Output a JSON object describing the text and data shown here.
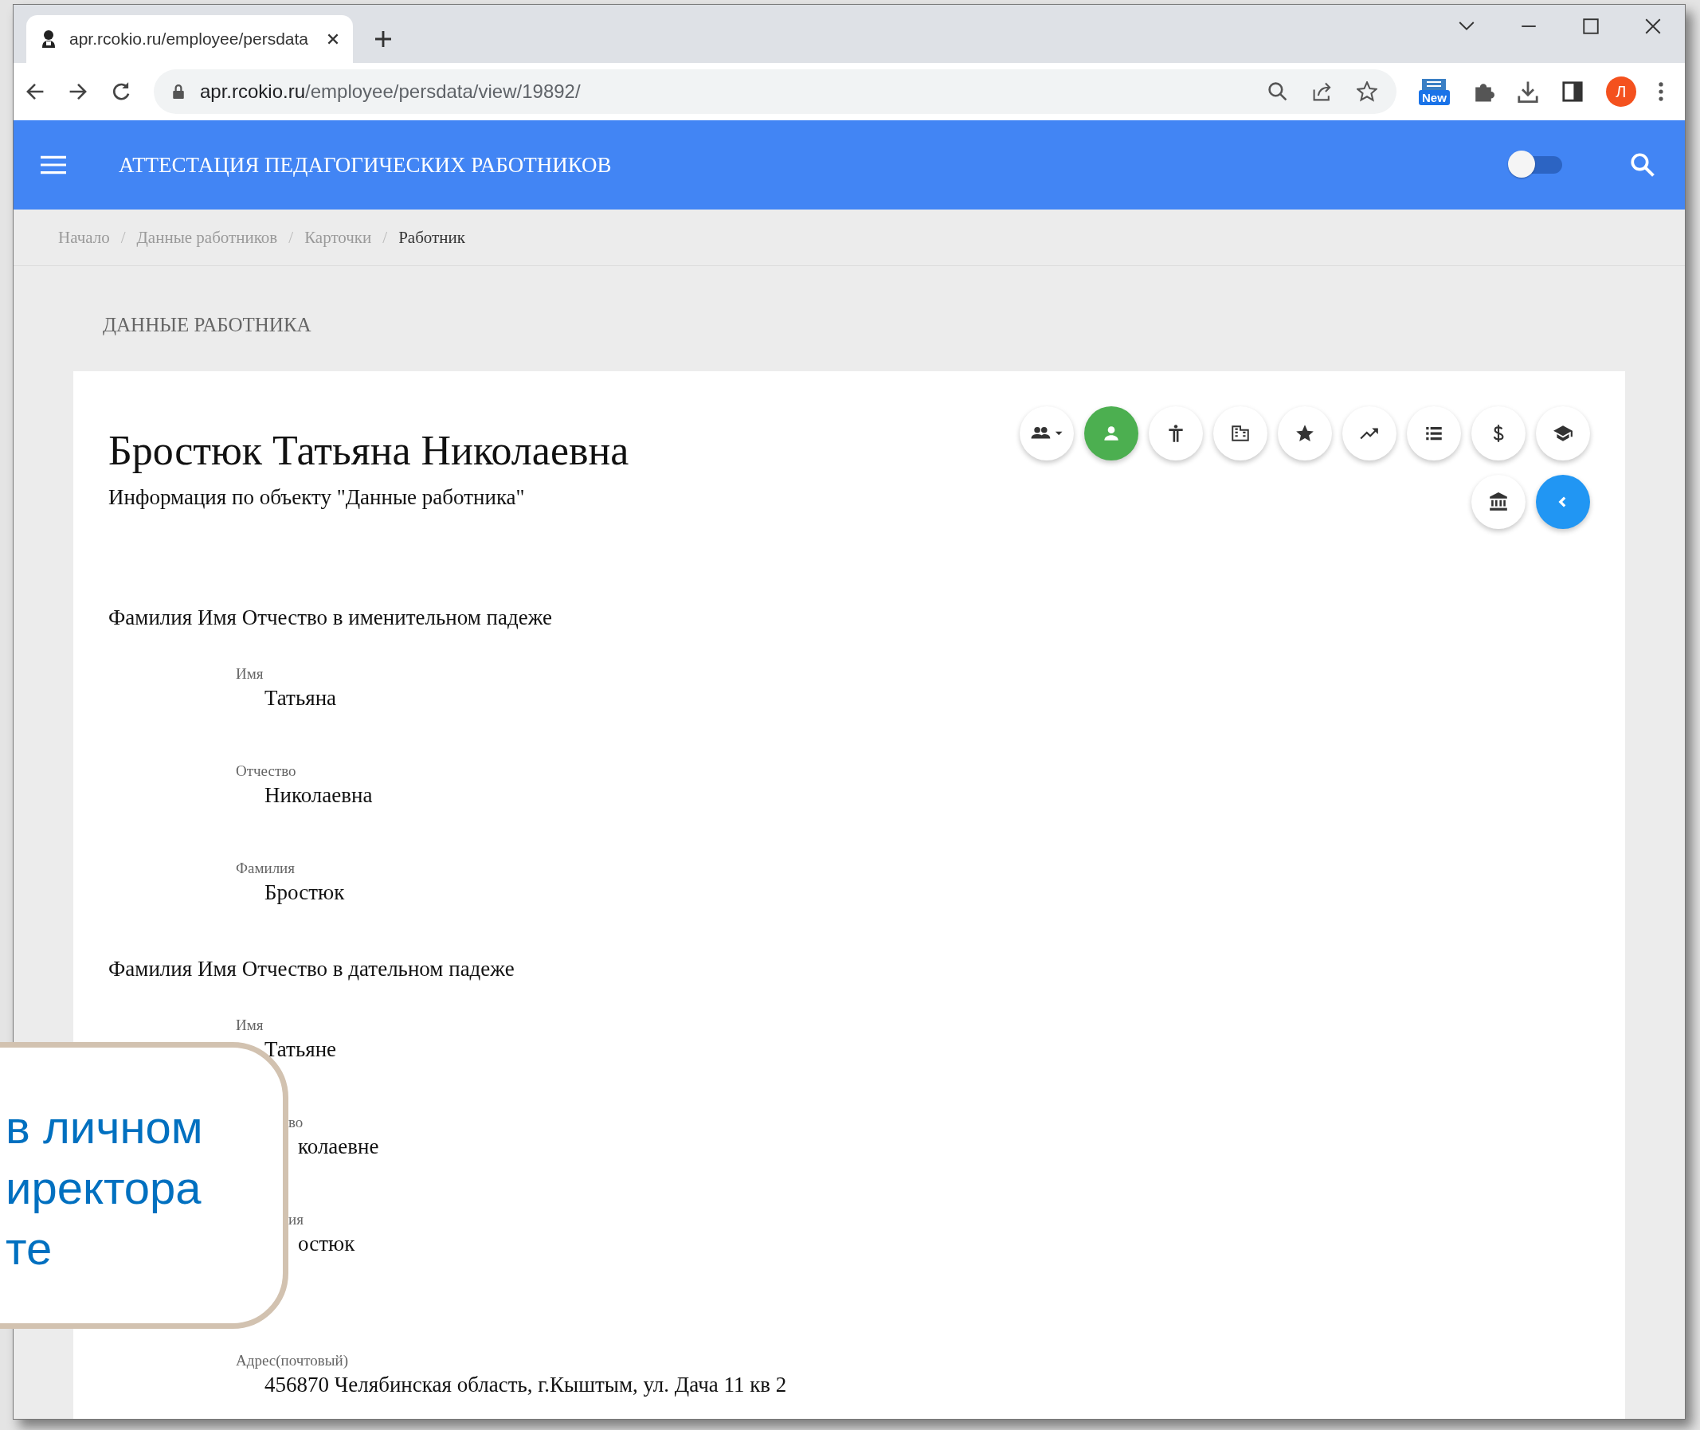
{
  "browser": {
    "tab_title": "apr.rcokio.ru/employee/persdata",
    "url_host": "apr.rcokio.ru",
    "url_path": "/employee/persdata/view/19892/",
    "extension_badge": "New",
    "profile_initial": "Л"
  },
  "app_bar": {
    "title": "АТТЕСТАЦИЯ ПЕДАГОГИЧЕСКИХ РАБОТНИКОВ",
    "toggle_on": false
  },
  "breadcrumb_separator": "/",
  "breadcrumbs": [
    {
      "label": "Начало",
      "current": false
    },
    {
      "label": "Данные работников",
      "current": false
    },
    {
      "label": "Карточки",
      "current": false
    },
    {
      "label": "Работник",
      "current": true
    }
  ],
  "page_title": "ДАННЫЕ РАБОТНИКА",
  "card": {
    "name": "Бростюк Татьяна Николаевна",
    "subtitle": "Информация по объекту \"Данные работника\"",
    "actions": [
      {
        "kind": "group",
        "selected": false
      },
      {
        "kind": "person",
        "selected": true
      },
      {
        "kind": "accessibility",
        "selected": false
      },
      {
        "kind": "building",
        "selected": false
      },
      {
        "kind": "star",
        "selected": false
      },
      {
        "kind": "trend",
        "selected": false
      },
      {
        "kind": "list",
        "selected": false
      },
      {
        "kind": "dollar",
        "selected": false
      },
      {
        "kind": "school",
        "selected": false
      },
      {
        "kind": "bank",
        "selected": false
      },
      {
        "kind": "back",
        "selected": false
      }
    ],
    "sections": [
      {
        "title": "Фамилия Имя Отчество в именительном падеже",
        "fields": [
          {
            "label": "Имя",
            "value": "Татьяна",
            "covered": false
          },
          {
            "label": "Отчество",
            "value": "Николаевна",
            "covered": false
          },
          {
            "label": "Фамилия",
            "value": "Бростюк",
            "covered": false
          }
        ]
      },
      {
        "title": "Фамилия Имя Отчество в дательном падеже",
        "fields": [
          {
            "label": "Имя",
            "value": "Татьяне",
            "covered": false
          },
          {
            "label": "во",
            "value": "колаевне",
            "covered": true
          },
          {
            "label": "ия",
            "value": "остюк",
            "covered": true
          }
        ]
      }
    ],
    "address": {
      "label": "Адрес(почтовый)",
      "value": "456870 Челябинская область, г.Кыштым, ул. Дача 11 кв 2"
    }
  },
  "callout": {
    "lines": [
      "в личном",
      "иректора",
      "те"
    ]
  }
}
